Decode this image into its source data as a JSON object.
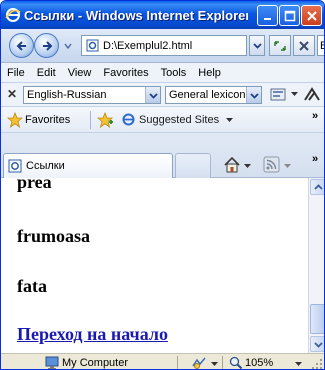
{
  "window": {
    "title": "Ссылки - Windows Internet Explorer",
    "icons": {
      "app": "ie-logo-icon",
      "minimize": "minimize-icon",
      "maximize": "maximize-icon",
      "close": "close-icon"
    }
  },
  "address_bar": {
    "url": "D:\\Exemplul2.html",
    "search_fragment": "B",
    "icons": {
      "back": "back-arrow-icon",
      "forward": "forward-arrow-icon",
      "refresh": "refresh-icon",
      "stop": "stop-icon",
      "page": "page-icon"
    }
  },
  "menu": {
    "items": [
      "File",
      "Edit",
      "View",
      "Favorites",
      "Tools",
      "Help"
    ]
  },
  "translate_bar": {
    "language": "English-Russian",
    "dictionary": "General lexicon",
    "icons": {
      "close": "close-icon",
      "translate": "translate-icon",
      "dictionary": "dictionary-icon"
    }
  },
  "favorites_bar": {
    "label": "Favorites",
    "suggested": "Suggested Sites",
    "chevron": "»",
    "icons": {
      "star": "star-icon",
      "add": "add-favorite-icon",
      "suggested": "ie-logo-icon"
    }
  },
  "tab_bar": {
    "tab_label": "Ссылки",
    "chevron": "»",
    "icons": {
      "tab": "ie-page-icon",
      "home": "home-icon",
      "rss": "rss-icon"
    }
  },
  "content": {
    "words": [
      "prea",
      "frumoasa",
      "fata"
    ],
    "link": "Переход на начало"
  },
  "status_bar": {
    "zone": "My Computer",
    "zoom": "105%",
    "icons": {
      "zone": "computer-icon",
      "protection": "protected-mode-icon",
      "zoom": "zoom-icon"
    }
  },
  "colors": {
    "title_bar": "#0a58e0",
    "link": "#1a1ab0",
    "chrome": "#ece9d8"
  }
}
